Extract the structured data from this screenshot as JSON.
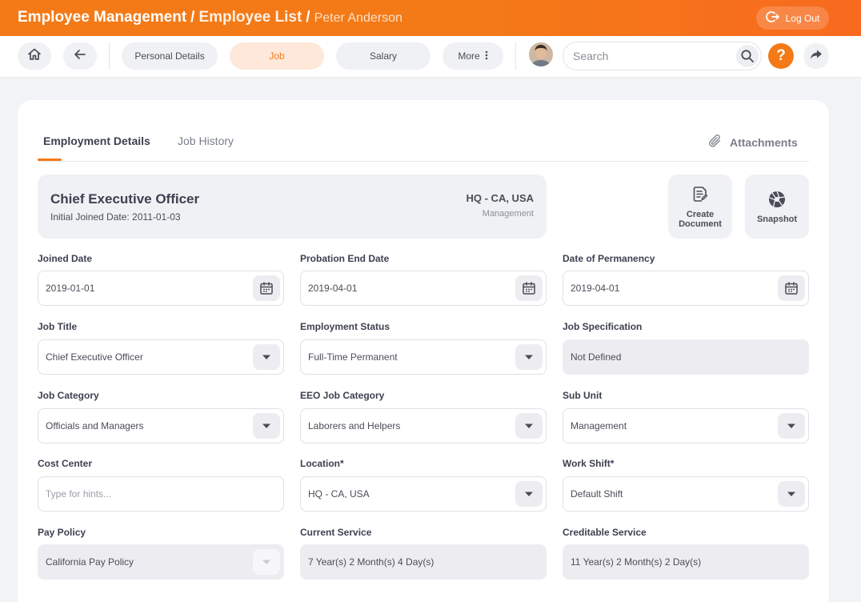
{
  "header": {
    "breadcrumb": [
      "Employee Management",
      "Employee List",
      "Peter Anderson"
    ],
    "separator": "/",
    "logout_label": "Log Out"
  },
  "nav": {
    "tabs": [
      {
        "label": "Personal Details"
      },
      {
        "label": "Job"
      },
      {
        "label": "Salary"
      },
      {
        "label": "More"
      }
    ],
    "active_tab": "Job",
    "search_placeholder": "Search",
    "help_label": "?"
  },
  "content": {
    "tabs": [
      "Employment Details",
      "Job History"
    ],
    "attachments_label": "Attachments",
    "summary": {
      "title": "Chief Executive Officer",
      "subtitle": "Initial Joined Date: 2011-01-03",
      "location": "HQ - CA, USA",
      "unit": "Management"
    },
    "actions": {
      "create_document_line1": "Create",
      "create_document_line2": "Document",
      "snapshot": "Snapshot"
    },
    "fields": {
      "joined_date": {
        "label": "Joined Date",
        "value": "2019-01-01"
      },
      "probation_end_date": {
        "label": "Probation End Date",
        "value": "2019-04-01"
      },
      "date_of_permanency": {
        "label": "Date of Permanency",
        "value": "2019-04-01"
      },
      "job_title": {
        "label": "Job Title",
        "value": "Chief Executive Officer"
      },
      "employment_status": {
        "label": "Employment Status",
        "value": "Full-Time Permanent"
      },
      "job_specification": {
        "label": "Job Specification",
        "value": "Not Defined"
      },
      "job_category": {
        "label": "Job Category",
        "value": "Officials and Managers"
      },
      "eeo_job_category": {
        "label": "EEO Job Category",
        "value": "Laborers and Helpers"
      },
      "sub_unit": {
        "label": "Sub Unit",
        "value": "Management"
      },
      "cost_center": {
        "label": "Cost Center",
        "placeholder": "Type for hints..."
      },
      "location": {
        "label": "Location*",
        "value": "HQ - CA, USA"
      },
      "work_shift": {
        "label": "Work Shift*",
        "value": "Default Shift"
      },
      "pay_policy": {
        "label": "Pay Policy",
        "value": "California Pay Policy"
      },
      "current_service": {
        "label": "Current Service",
        "value": "7 Year(s) 2 Month(s) 4 Day(s)"
      },
      "creditable_service": {
        "label": "Creditable Service",
        "value": "11 Year(s) 2 Month(s) 2 Day(s)"
      }
    }
  },
  "colors": {
    "accent": "#f47a17",
    "accent_light": "#fde8da",
    "surface": "#f0f1f4"
  }
}
